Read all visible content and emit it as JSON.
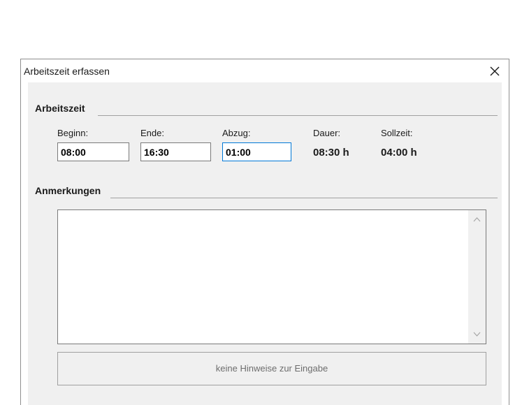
{
  "window": {
    "title": "Arbeitszeit erfassen",
    "close_icon": "close-icon"
  },
  "arbeitszeit": {
    "section_title": "Arbeitszeit",
    "beginn": {
      "label": "Beginn:",
      "value": "08:00"
    },
    "ende": {
      "label": "Ende:",
      "value": "16:30"
    },
    "abzug": {
      "label": "Abzug:",
      "value": "01:00"
    },
    "dauer": {
      "label": "Dauer:",
      "value": "08:30 h"
    },
    "sollzeit": {
      "label": "Sollzeit:",
      "value": "04:00 h"
    }
  },
  "anmerkungen": {
    "section_title": "Anmerkungen",
    "text": ""
  },
  "hint": {
    "text": "keine Hinweise zur Eingabe"
  },
  "colors": {
    "focus_border": "#0078d7",
    "panel_background": "#f0f0f0",
    "hint_text": "#6d6d6d"
  }
}
